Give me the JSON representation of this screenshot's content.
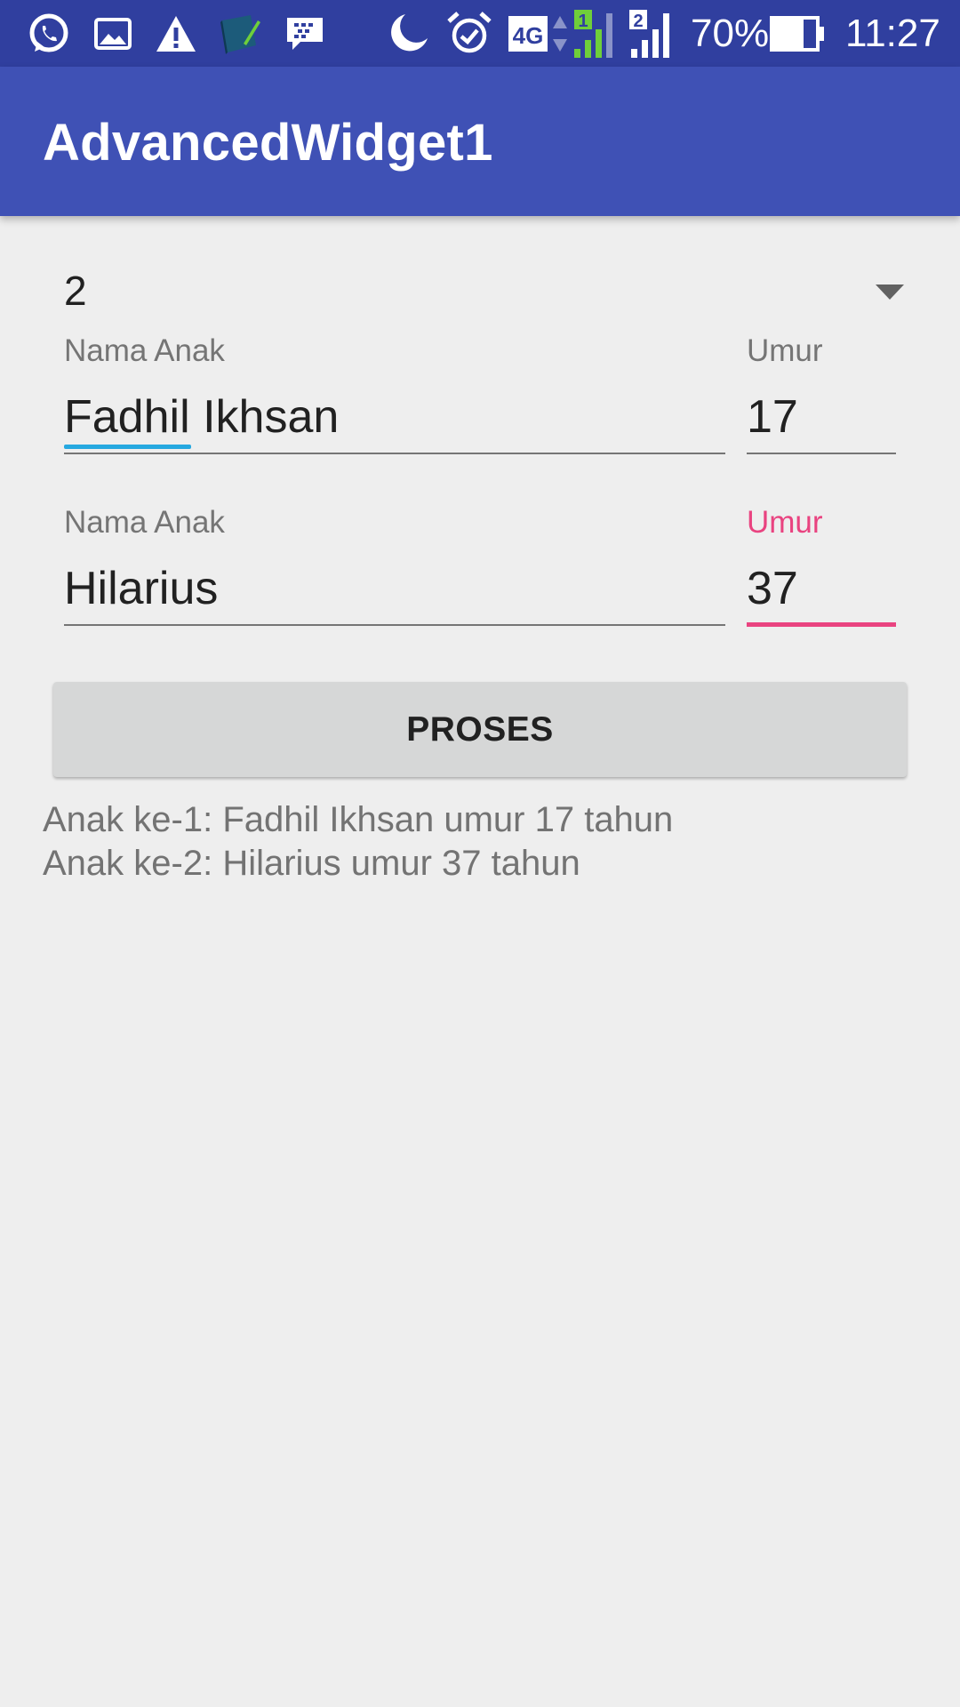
{
  "status_bar": {
    "icons": [
      "whatsapp-icon",
      "gallery-icon",
      "warning-icon",
      "book-app-icon",
      "bbm-icon",
      "moon-icon",
      "alarm-icon",
      "network-4g-icon",
      "signal-sim1-icon",
      "signal-sim2-icon",
      "battery-icon"
    ],
    "network_type": "4G",
    "sim1_label": "1",
    "sim2_label": "2",
    "battery": "70%",
    "time": "11:27"
  },
  "app_bar": {
    "title": "AdvancedWidget1"
  },
  "spinner": {
    "value": "2",
    "icon": "dropdown-arrow-icon"
  },
  "children": [
    {
      "name_label": "Nama Anak",
      "name_value": "Fadhil Ikhsan",
      "age_label": "Umur",
      "age_value": "17"
    },
    {
      "name_label": "Nama Anak",
      "name_value": "Hilarius",
      "age_label": "Umur",
      "age_value": "37"
    }
  ],
  "button": {
    "label": "PROSES"
  },
  "results": [
    "Anak ke-1: Fadhil Ikhsan umur 17 tahun",
    "Anak ke-2: Hilarius umur 37 tahun"
  ],
  "colors": {
    "status_bar": "#303f9f",
    "app_bar": "#3f51b5",
    "accent": "#e94380",
    "spellcheck": "#26a8e0",
    "background": "#eeeeee",
    "button": "#d6d7d7"
  }
}
